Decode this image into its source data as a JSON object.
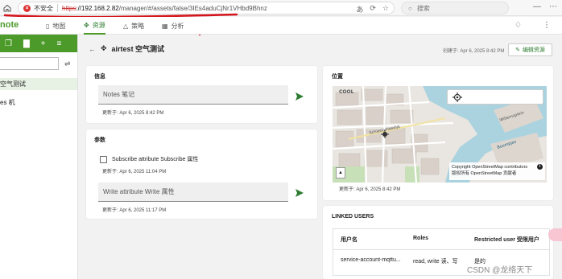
{
  "browser": {
    "security_label": "不安全",
    "url_scheme": "https",
    "url_host": "://192.168.2.82",
    "url_path": "/manager/#/assets/false/3IEs4aduCjNr1VHbd9Bhnz",
    "search_placeholder": "搜索"
  },
  "app": {
    "brand": "note",
    "nav": [
      {
        "icon": "map-icon",
        "label": "地图"
      },
      {
        "icon": "asset-icon",
        "label": "资源"
      },
      {
        "icon": "rule-icon",
        "label": "策略"
      },
      {
        "icon": "insights-icon",
        "label": "分析"
      }
    ],
    "active_nav": "资源"
  },
  "sidebar": {
    "items": [
      {
        "label": "空气测试",
        "selected": true
      },
      {
        "label": "es 机",
        "selected": false
      }
    ]
  },
  "asset": {
    "name": "airtest 空气测试",
    "created": "创建于: Apr 6, 2025 8:42 PM",
    "edit_label": "编辑资源"
  },
  "info_card": {
    "title": "信息",
    "notes_field": "Notes 笔记",
    "updated": "更新于: Apr 6, 2025 8:42 PM"
  },
  "params_card": {
    "title": "参数",
    "subscribe_label": "Subscribe attribute Subscribe 属性",
    "subscribe_updated": "更新于: Apr 6, 2025 11:04 PM",
    "write_field": "Write attribute Write 属性",
    "write_updated": "更新于: Apr 6, 2025 11:17 PM"
  },
  "location_card": {
    "title": "位置",
    "attribution_line1": "Copyright OpenStreetMap contributors",
    "attribution_line2": "版权所有 OpenStreetMap 贡献者",
    "updated": "更新于: Apr 6, 2025 8:42 PM",
    "map_labels": [
      "COOL",
      "Schiedamsedijk",
      "Boompjes",
      "Willemsplein"
    ]
  },
  "linked_users": {
    "title": "LINKED USERS",
    "columns": [
      "用户名",
      "Roles",
      "Restricted user 受限用户"
    ],
    "rows": [
      {
        "username": "service-account-mqttu...",
        "roles": "read, write 读、写",
        "restricted": "是的"
      }
    ]
  },
  "watermark": "CSDN @龙络天下",
  "colors": {
    "brand_green": "#4c9a2a",
    "accent_green": "#2e7d32",
    "security_red": "#d33333"
  }
}
